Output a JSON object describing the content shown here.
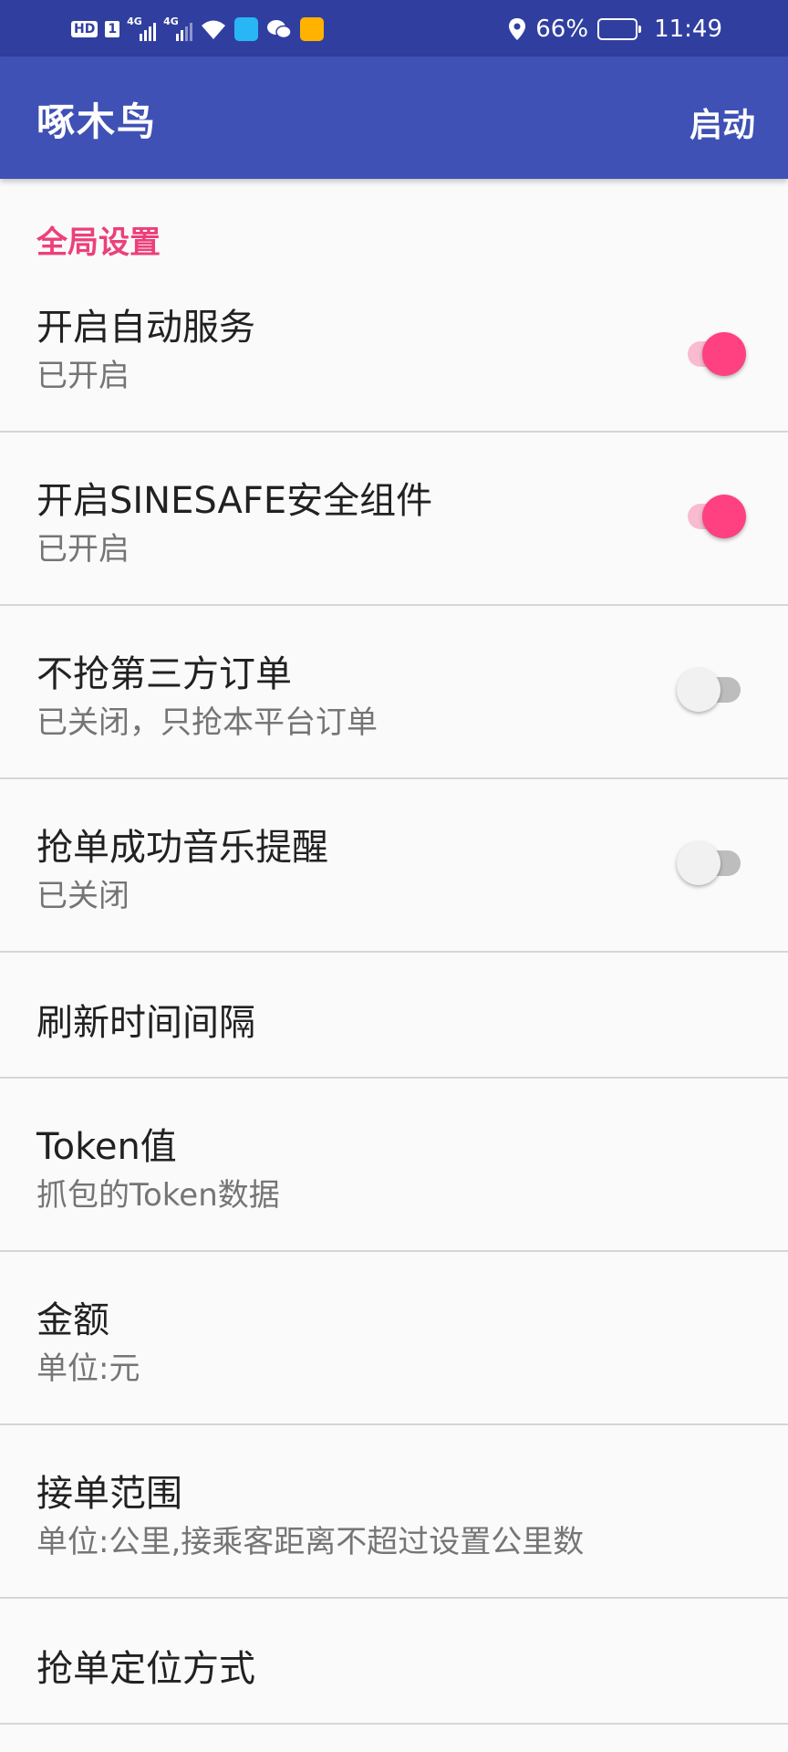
{
  "status_bar": {
    "hd": "HD",
    "sim": "1",
    "net1": "4G",
    "net2": "4G",
    "battery_text": "66%",
    "battery_level": 0.66,
    "time": "11:49"
  },
  "app_bar": {
    "title": "啄木鸟",
    "action": "启动"
  },
  "section": {
    "title": "全局设置"
  },
  "prefs": [
    {
      "title": "开启自动服务",
      "summary": "已开启",
      "switch_on": true
    },
    {
      "title": "开启SINESAFE安全组件",
      "summary": "已开启",
      "switch_on": true
    },
    {
      "title": "不抢第三方订单",
      "summary": "已关闭，只抢本平台订单",
      "switch_on": false
    },
    {
      "title": "抢单成功音乐提醒",
      "summary": "已关闭",
      "switch_on": false
    },
    {
      "title": "刷新时间间隔"
    },
    {
      "title": "Token值",
      "summary": "抓包的Token数据"
    },
    {
      "title": "金额",
      "summary": "单位:元"
    },
    {
      "title": "接单范围",
      "summary": "单位:公里,接乘客距离不超过设置公里数"
    },
    {
      "title": "抢单定位方式"
    }
  ],
  "colors": {
    "primary": "#3f51b5",
    "primary_dark": "#303f9f",
    "accent": "#ff4081"
  }
}
